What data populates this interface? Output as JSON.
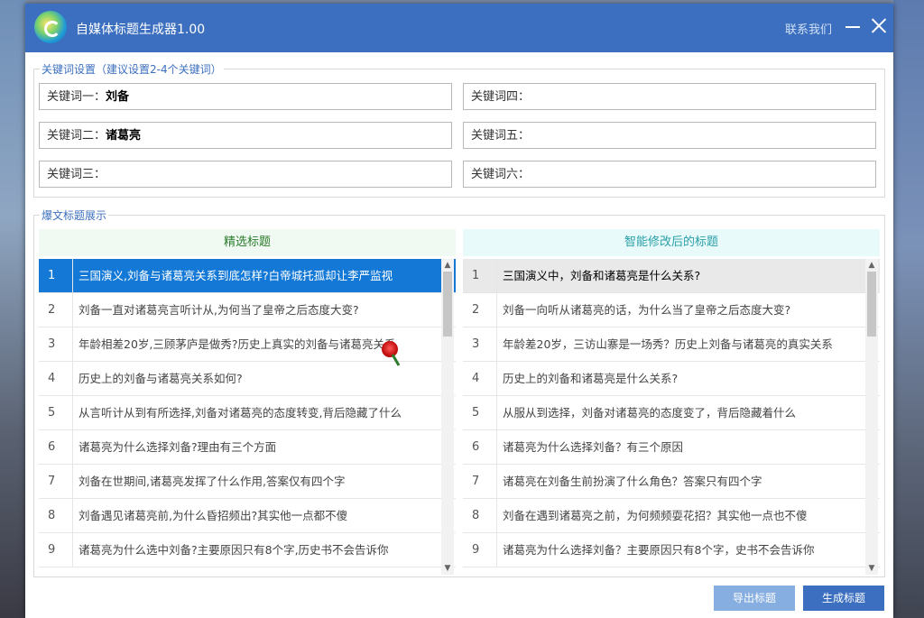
{
  "app": {
    "title": "自媒体标题生成器1.00",
    "contact_label": "联系我们"
  },
  "keywords": {
    "legend": "关键词设置（建议设置2-4个关键词）",
    "fields": [
      {
        "label": "关键词一：",
        "value": "刘备"
      },
      {
        "label": "关键词二：",
        "value": "诸葛亮"
      },
      {
        "label": "关键词三：",
        "value": ""
      },
      {
        "label": "关键词四：",
        "value": ""
      },
      {
        "label": "关键词五：",
        "value": ""
      },
      {
        "label": "关键词六：",
        "value": ""
      }
    ]
  },
  "titles": {
    "legend": "爆文标题展示",
    "left_header": "精选标题",
    "right_header": "智能修改后的标题",
    "left_rows": [
      {
        "num": "1",
        "text": "三国演义,刘备与诸葛亮关系到底怎样?白帝城托孤却让李严监视"
      },
      {
        "num": "2",
        "text": "刘备一直对诸葛亮言听计从,为何当了皇帝之后态度大变?"
      },
      {
        "num": "3",
        "text": "年龄相差20岁,三顾茅庐是做秀?历史上真实的刘备与诸葛亮关系"
      },
      {
        "num": "4",
        "text": "历史上的刘备与诸葛亮关系如何?"
      },
      {
        "num": "5",
        "text": "从言听计从到有所选择,刘备对诸葛亮的态度转变,背后隐藏了什么"
      },
      {
        "num": "6",
        "text": "诸葛亮为什么选择刘备?理由有三个方面"
      },
      {
        "num": "7",
        "text": "刘备在世期间,诸葛亮发挥了什么作用,答案仅有四个字"
      },
      {
        "num": "8",
        "text": "刘备遇见诸葛亮前,为什么昏招频出?其实他一点都不傻"
      },
      {
        "num": "9",
        "text": "诸葛亮为什么选中刘备?主要原因只有8个字,历史书不会告诉你"
      }
    ],
    "right_rows": [
      {
        "num": "1",
        "text": "三国演义中，刘备和诸葛亮是什么关系?"
      },
      {
        "num": "2",
        "text": "刘备一向听从诸葛亮的话，为什么当了皇帝之后态度大变?"
      },
      {
        "num": "3",
        "text": "年龄差20岁，三访山寨是一场秀？历史上刘备与诸葛亮的真实关系"
      },
      {
        "num": "4",
        "text": "历史上的刘备和诸葛亮是什么关系?"
      },
      {
        "num": "5",
        "text": "从服从到选择，刘备对诸葛亮的态度变了，背后隐藏着什么"
      },
      {
        "num": "6",
        "text": "诸葛亮为什么选择刘备？有三个原因"
      },
      {
        "num": "7",
        "text": "诸葛亮在刘备生前扮演了什么角色？答案只有四个字"
      },
      {
        "num": "8",
        "text": "刘备在遇到诸葛亮之前，为何频频耍花招？其实他一点也不傻"
      },
      {
        "num": "9",
        "text": "诸葛亮为什么选择刘备？主要原因只有8个字，史书不会告诉你"
      }
    ]
  },
  "buttons": {
    "export": "导出标题",
    "generate": "生成标题"
  },
  "colors": {
    "titlebar": "#3c6fbf",
    "selected_row": "#1479d6",
    "export_button": "#86aee0",
    "generate_button": "#3c6fbf"
  },
  "icons": [
    "app-logo-icon",
    "minimize-icon",
    "close-icon",
    "scroll-up-icon",
    "scroll-down-icon",
    "rose-cursor-icon"
  ]
}
